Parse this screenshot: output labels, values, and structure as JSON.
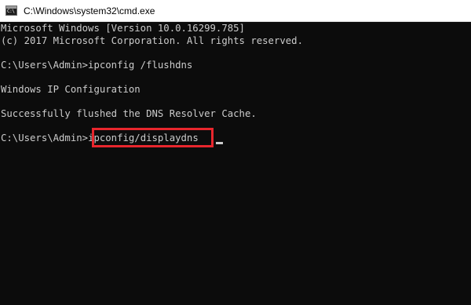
{
  "window": {
    "title": "C:\\Windows\\system32\\cmd.exe",
    "icon": "cmd-icon",
    "icon_glyph": "C:\\"
  },
  "console": {
    "lines": [
      "Microsoft Windows [Version 10.0.16299.785]",
      "(c) 2017 Microsoft Corporation. All rights reserved.",
      "C:\\Users\\Admin>ipconfig /flushdns",
      "Windows IP Configuration",
      "Successfully flushed the DNS Resolver Cache."
    ],
    "current_prompt": "C:\\Users\\Admin>",
    "current_command": "ipconfig/displaydns",
    "highlight_color": "#e8262d",
    "text_color": "#cccccc",
    "background_color": "#0c0c0c"
  }
}
